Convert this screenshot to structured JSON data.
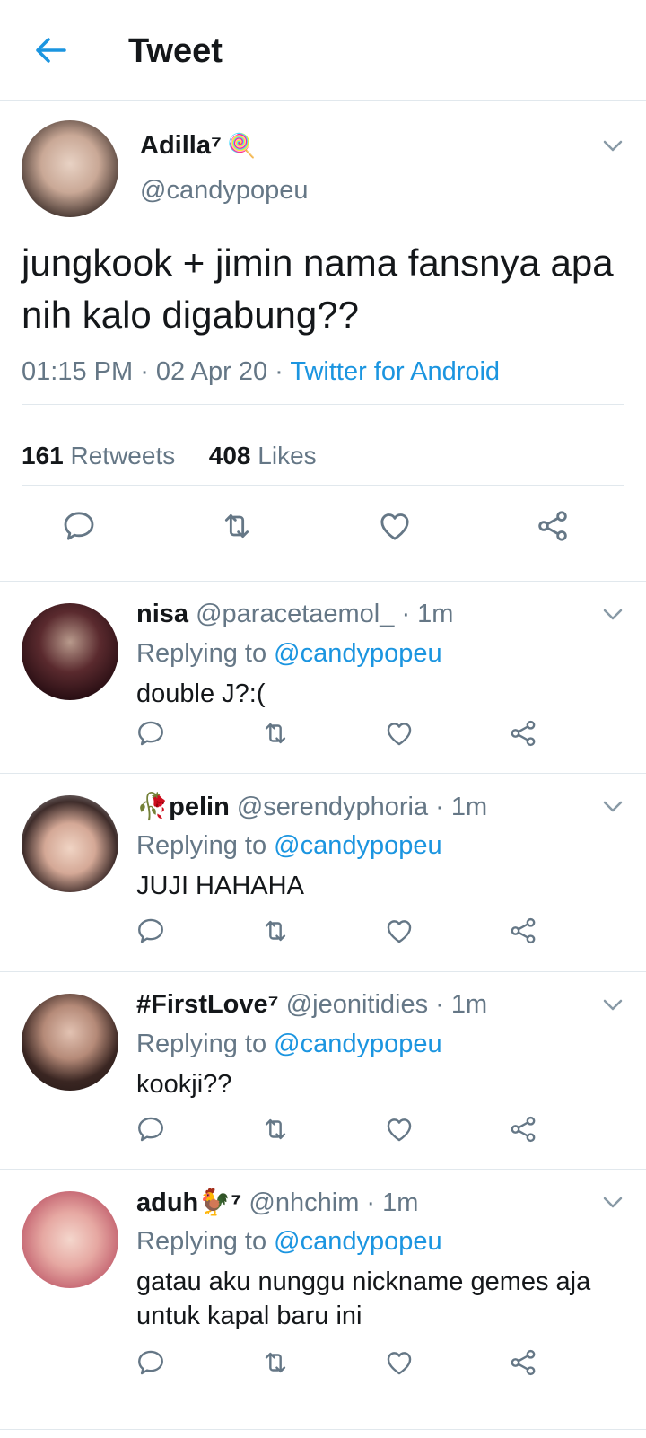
{
  "header": {
    "title": "Tweet",
    "back_icon": "arrow-left-icon"
  },
  "colors": {
    "accent": "#1b95e0",
    "text": "#14171a",
    "muted": "#657786",
    "divider": "#e1e8ed"
  },
  "main": {
    "name": "Adilla⁷",
    "name_emoji": "🍭",
    "handle": "@candypopeu",
    "text": "jungkook + jimin nama fansnya apa nih kalo digabung??",
    "time": "01:15 PM",
    "date": "02 Apr 20",
    "source": "Twitter for Android",
    "retweets_count": "161",
    "retweets_label": "Retweets",
    "likes_count": "408",
    "likes_label": "Likes"
  },
  "replies": [
    {
      "name": "nisa",
      "handle": "@paracetaemol_",
      "time": "1m",
      "replying_label": "Replying to",
      "replying_to": "@candypopeu",
      "text": "double J?:("
    },
    {
      "name": "🥀pelin",
      "handle": "@serendyphoria",
      "time": "1m",
      "replying_label": "Replying to",
      "replying_to": "@candypopeu",
      "text": "JUJI HAHAHA"
    },
    {
      "name": "#FirstLove⁷",
      "handle": "@jeonitidies",
      "time": "1m",
      "replying_label": "Replying to",
      "replying_to": "@candypopeu",
      "text": "kookji??"
    },
    {
      "name": "aduh🐓⁷",
      "handle": "@nhchim",
      "time": "1m",
      "replying_label": "Replying to",
      "replying_to": "@candypopeu",
      "text": "gatau aku nunggu nickname gemes aja untuk kapal baru ini"
    }
  ]
}
